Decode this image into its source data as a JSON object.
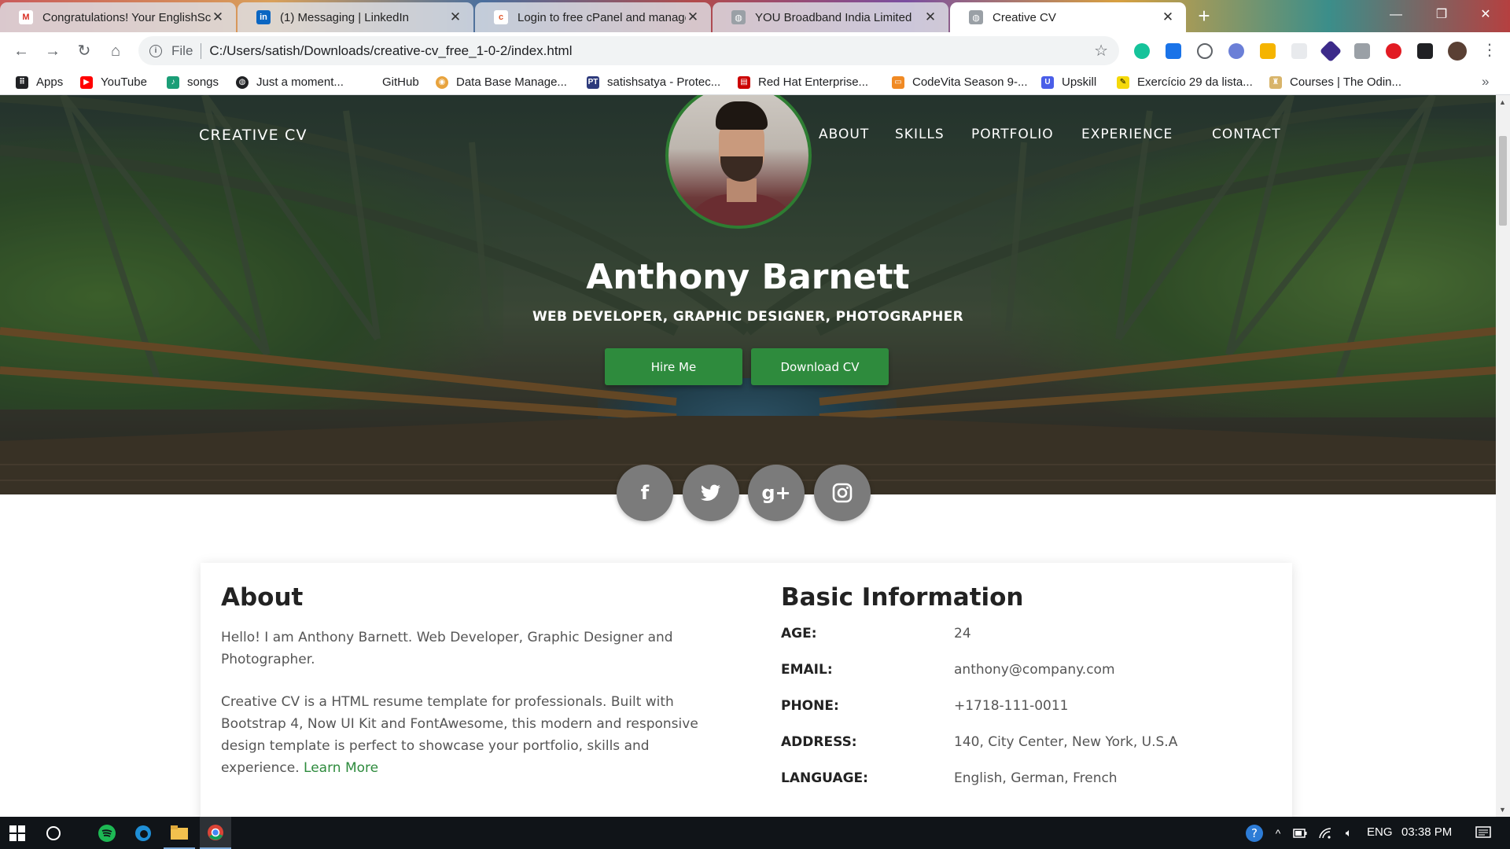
{
  "browser": {
    "tabs": [
      {
        "title": "Congratulations! Your EnglishSc",
        "icon": "gmail-icon"
      },
      {
        "title": "(1) Messaging | LinkedIn",
        "icon": "linkedin-icon"
      },
      {
        "title": "Login to free cPanel and manage",
        "icon": "cpanel-icon"
      },
      {
        "title": "YOU Broadband India Limited",
        "icon": "globe-icon"
      },
      {
        "title": "Creative CV",
        "icon": "globe-icon",
        "active": true
      }
    ],
    "omnibox": {
      "scheme": "File",
      "url": "C:/Users/satish/Downloads/creative-cv_free_1-0-2/index.html"
    },
    "bookmarks": [
      {
        "label": "Apps",
        "icon": "apps-grid-icon"
      },
      {
        "label": "YouTube",
        "icon": "youtube-icon"
      },
      {
        "label": "songs",
        "icon": "songs-icon"
      },
      {
        "label": "Just a moment...",
        "icon": "globe-icon"
      },
      {
        "label": "GitHub",
        "icon": "github-icon"
      },
      {
        "label": "Data Base Manage...",
        "icon": "database-icon"
      },
      {
        "label": "satishsatya - Protec...",
        "icon": "pt-icon"
      },
      {
        "label": "Red Hat Enterprise...",
        "icon": "redhat-icon"
      },
      {
        "label": "CodeVita Season 9-...",
        "icon": "codevita-icon"
      },
      {
        "label": "Upskill",
        "icon": "upskill-icon"
      },
      {
        "label": "Exercício 29 da lista...",
        "icon": "pencil-icon"
      },
      {
        "label": "Courses | The Odin...",
        "icon": "odin-icon"
      }
    ]
  },
  "site": {
    "brand": "CREATIVE CV",
    "nav": [
      "ABOUT",
      "SKILLS",
      "PORTFOLIO",
      "EXPERIENCE",
      "CONTACT"
    ],
    "name": "Anthony Barnett",
    "roles": "WEB DEVELOPER, GRAPHIC DESIGNER, PHOTOGRAPHER",
    "buttons": {
      "hire": "Hire Me",
      "download": "Download CV"
    },
    "social": [
      "f",
      "g+"
    ]
  },
  "about": {
    "heading": "About",
    "p1": "Hello! I am Anthony Barnett. Web Developer, Graphic Designer and Photographer.",
    "p2": "Creative CV is a HTML resume template for professionals. Built with Bootstrap 4, Now UI Kit and FontAwesome, this modern and responsive design template is perfect to showcase your portfolio, skills and experience.",
    "link": "Learn More"
  },
  "basic_info": {
    "heading": "Basic Information",
    "rows": [
      {
        "key": "AGE:",
        "value": "24"
      },
      {
        "key": "EMAIL:",
        "value": "anthony@company.com"
      },
      {
        "key": "PHONE:",
        "value": "+1718-111-0011"
      },
      {
        "key": "ADDRESS:",
        "value": "140, City Center, New York, U.S.A"
      },
      {
        "key": "LANGUAGE:",
        "value": "English, German, French"
      }
    ]
  },
  "taskbar": {
    "lang": "ENG",
    "time": "03:38 PM"
  },
  "colors": {
    "accent": "#2e8b3d",
    "social": "#7b7b7b"
  }
}
